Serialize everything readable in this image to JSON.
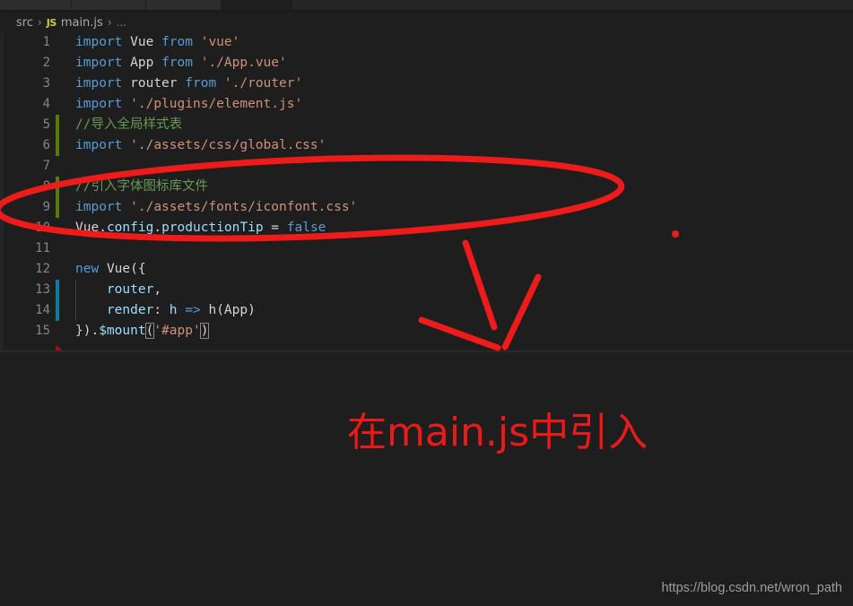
{
  "window": {
    "app": "vscode-editor",
    "background_color": "#1e1e1e"
  },
  "tabs": [
    {
      "name": "tab-1",
      "state": "inactive"
    },
    {
      "name": "tab-2",
      "state": "inactive"
    },
    {
      "name": "tab-3",
      "state": "inactive"
    },
    {
      "name": "tab-4",
      "state": "active"
    },
    {
      "name": "tab-5",
      "state": "inactive"
    }
  ],
  "breadcrumb": {
    "folder": "src",
    "separator": "›",
    "file_icon_label": "JS",
    "file": "main.js",
    "symbol_placeholder": "…"
  },
  "editor": {
    "language": "javascript",
    "lines": [
      {
        "num": "1",
        "gutter": "none",
        "text": "import Vue from 'vue'"
      },
      {
        "num": "2",
        "gutter": "none",
        "text": "import App from './App.vue'"
      },
      {
        "num": "3",
        "gutter": "none",
        "text": "import router from './router'"
      },
      {
        "num": "4",
        "gutter": "none",
        "text": "import './plugins/element.js'"
      },
      {
        "num": "5",
        "gutter": "green",
        "text": "//导入全局样式表"
      },
      {
        "num": "6",
        "gutter": "green",
        "text": "import './assets/css/global.css'"
      },
      {
        "num": "7",
        "gutter": "none",
        "text": ""
      },
      {
        "num": "8",
        "gutter": "green",
        "text": "//引入字体图标库文件"
      },
      {
        "num": "9",
        "gutter": "green",
        "text": "import './assets/fonts/iconfont.css'"
      },
      {
        "num": "10",
        "gutter": "none",
        "text": "Vue.config.productionTip = false"
      },
      {
        "num": "11",
        "gutter": "none",
        "text": ""
      },
      {
        "num": "12",
        "gutter": "none",
        "text": "new Vue({"
      },
      {
        "num": "13",
        "gutter": "blue",
        "text": "    router,"
      },
      {
        "num": "14",
        "gutter": "blue",
        "text": "    render: h => h(App)"
      },
      {
        "num": "15",
        "gutter": "none",
        "text": "}).$mount('#app')"
      }
    ],
    "error_marker": "error-triangle"
  },
  "annotations": {
    "callout_text": "在main.js中引入",
    "callout_color": "#e81a1a",
    "ellipse_label": "highlight-ellipse",
    "arrow_label": "pointer-arrow",
    "dot_label": "ink-dot"
  },
  "watermark": {
    "url": "https://blog.csdn.net/wron_path"
  }
}
